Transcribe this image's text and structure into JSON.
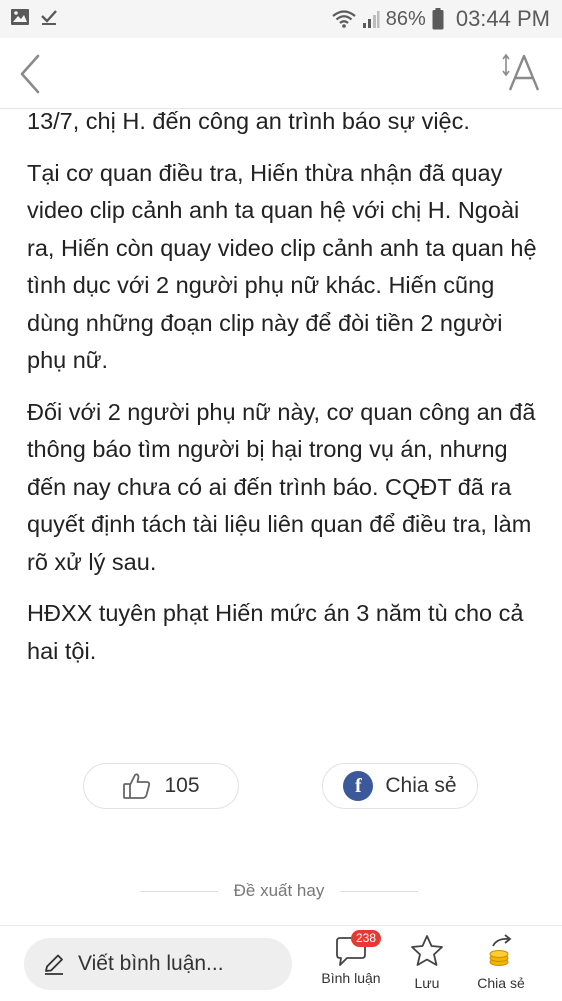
{
  "status_bar": {
    "battery_percent": "86%",
    "time": "03:44 PM",
    "icons": [
      "image-icon",
      "download-done-icon",
      "wifi-icon",
      "signal-icon",
      "battery-icon"
    ]
  },
  "top_bar": {
    "icons": [
      "back-chevron-icon",
      "font-size-icon"
    ]
  },
  "article": {
    "paragraphs": [
      "13/7, chị H. đến công an trình báo sự việc.",
      "Tại cơ quan điều tra, Hiến thừa nhận đã quay video clip cảnh anh ta quan hệ với chị H. Ngoài ra, Hiến còn quay video clip cảnh anh ta quan hệ tình dục với 2 người phụ nữ khác. Hiến cũng dùng những đoạn clip này để đòi tiền 2 người phụ nữ.",
      "Đối với 2 người phụ nữ này, cơ quan công an đã thông báo tìm người bị hại trong vụ án, nhưng đến nay chưa có ai đến trình báo. CQĐT đã ra quyết định tách tài liệu liên quan để điều tra, làm rõ xử lý sau.",
      "HĐXX tuyên phạt Hiến mức án 3 năm tù cho cả hai tội."
    ]
  },
  "reactions": {
    "like_count": "105",
    "share_label": "Chia sẻ"
  },
  "suggest": {
    "label": "Đề xuất hay"
  },
  "bottom_bar": {
    "comment_placeholder": "Viết bình luận...",
    "comments_label": "Bình luận",
    "comments_badge": "238",
    "save_label": "Lưu",
    "share_label": "Chia sẻ"
  },
  "colors": {
    "facebook_blue": "#3b5998",
    "badge_red": "#e53935",
    "status_bar_bg": "#f5f5f5",
    "share_coin": "#f4b400"
  }
}
